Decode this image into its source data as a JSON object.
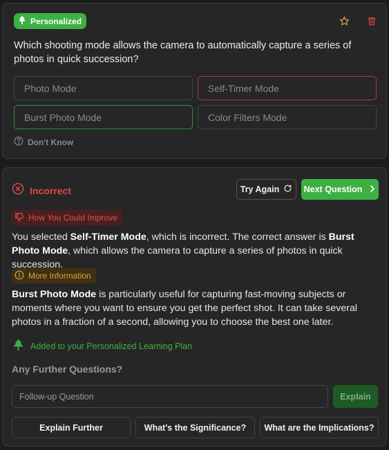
{
  "colors": {
    "accent_green": "#3cb043",
    "error_red": "#e04848",
    "info_amber": "#e0a53a",
    "card_bg": "#262626",
    "page_bg": "#1c1c1c"
  },
  "question_card": {
    "badge": {
      "label": "Personalized",
      "icon": "tree-icon"
    },
    "actions": {
      "favorite_icon": "star-icon",
      "delete_icon": "trash-icon"
    },
    "question": "Which shooting mode allows the camera to automatically capture a series of photos in quick succession?",
    "options": [
      {
        "label": "Photo Mode",
        "state": "default"
      },
      {
        "label": "Self-Timer Mode",
        "state": "selected-incorrect"
      },
      {
        "label": "Burst Photo Mode",
        "state": "correct"
      },
      {
        "label": "Color Filters Mode",
        "state": "default"
      }
    ],
    "dont_know": {
      "label": "Don't Know",
      "icon": "help-circle-icon"
    }
  },
  "feedback_card": {
    "status": {
      "label": "Incorrect",
      "icon": "x-circle-icon"
    },
    "try_again": {
      "label": "Try Again",
      "icon": "refresh-icon"
    },
    "next_question": {
      "label": "Next Question",
      "icon": "chevron-right-icon"
    },
    "improve": {
      "label": "How You Could Improve",
      "icon": "thumbs-down-icon",
      "text_1": "You selected ",
      "selected": "Self-Timer Mode",
      "text_2": ", which is incorrect. The correct answer is ",
      "correct": "Burst Photo Mode",
      "text_3": ", which allows the camera to capture a series of photos in quick succession."
    },
    "info": {
      "label": "More Information",
      "icon": "info-circle-icon",
      "term": "Burst Photo Mode",
      "text": " is particularly useful for capturing fast-moving subjects or moments where you want to ensure you get the perfect shot. It can take several photos in a fraction of a second, allowing you to choose the best one later."
    },
    "added": {
      "label": "Added to your Personalized Learning Plan",
      "icon": "tree-icon"
    },
    "further": {
      "title": "Any Further Questions?",
      "placeholder": "Follow-up Question",
      "explain": "Explain"
    },
    "suggestions": [
      "Explain Further",
      "What's the Significance?",
      "What are the Implications?"
    ]
  }
}
